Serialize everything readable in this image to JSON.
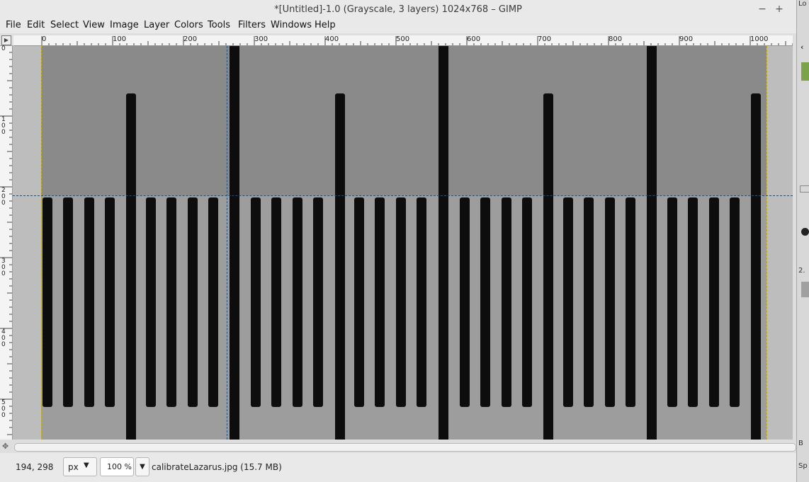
{
  "window": {
    "title": "*[Untitled]-1.0 (Grayscale, 3 layers) 1024x768 – GIMP",
    "minimize_glyph": "−",
    "maximize_glyph": "+",
    "close_glyph": "×"
  },
  "menu": [
    "File",
    "Edit",
    "Select",
    "View",
    "Image",
    "Layer",
    "Colors",
    "Tools",
    "Filters",
    "Windows",
    "Help"
  ],
  "ruler": {
    "h_labels": [
      "0",
      "100",
      "200",
      "300",
      "400",
      "500",
      "600",
      "700",
      "800",
      "900",
      "1000"
    ],
    "v_labels": [
      "0",
      "100",
      "200",
      "300",
      "400",
      "500"
    ]
  },
  "status": {
    "coords": "194, 298",
    "unit": "px",
    "zoom": "100 %",
    "text": "calibrateLazarus.jpg (15.7 MB)"
  },
  "right_panel": {
    "top": "Lo",
    "mid_label": "2.",
    "b_label": "B",
    "sp_label": "Sp"
  },
  "colors": {
    "scale_mark": "#0d0d0d",
    "guide": "#1a4f8c",
    "canvas_top": "#8a8a8a",
    "canvas_bottom": "#9d9d9d"
  }
}
